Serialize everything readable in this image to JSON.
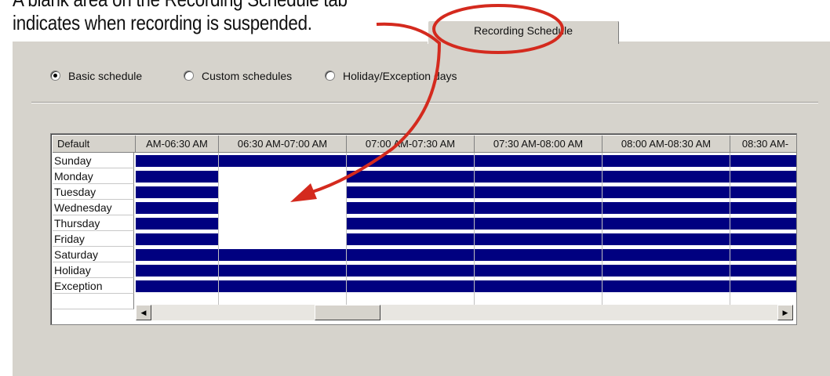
{
  "annotation": {
    "line1": "A blank area on the Recording Schedule tab",
    "line2": "indicates when recording is suspended."
  },
  "tab": {
    "label": "Recording Schedule"
  },
  "radio_options": [
    {
      "label": "Basic schedule",
      "selected": true
    },
    {
      "label": "Custom schedules",
      "selected": false
    },
    {
      "label": "Holiday/Exception days",
      "selected": false
    }
  ],
  "grid": {
    "corner_label": "Default",
    "columns": [
      "AM-06:30 AM",
      "06:30 AM-07:00 AM",
      "07:00 AM-07:30 AM",
      "07:30 AM-08:00 AM",
      "08:00 AM-08:30 AM",
      "08:30 AM-"
    ],
    "rows": [
      {
        "label": "Sunday",
        "recording": [
          true,
          true,
          true,
          true,
          true,
          true
        ]
      },
      {
        "label": "Monday",
        "recording": [
          true,
          false,
          true,
          true,
          true,
          true
        ]
      },
      {
        "label": "Tuesday",
        "recording": [
          true,
          false,
          true,
          true,
          true,
          true
        ]
      },
      {
        "label": "Wednesday",
        "recording": [
          true,
          false,
          true,
          true,
          true,
          true
        ]
      },
      {
        "label": "Thursday",
        "recording": [
          true,
          false,
          true,
          true,
          true,
          true
        ]
      },
      {
        "label": "Friday",
        "recording": [
          true,
          false,
          true,
          true,
          true,
          true
        ]
      },
      {
        "label": "Saturday",
        "recording": [
          true,
          true,
          true,
          true,
          true,
          true
        ]
      },
      {
        "label": "Holiday",
        "recording": [
          true,
          true,
          true,
          true,
          true,
          true
        ]
      },
      {
        "label": "Exception",
        "recording": [
          true,
          true,
          true,
          true,
          true,
          true
        ]
      }
    ]
  },
  "colors": {
    "recording_fill": "#000080",
    "panel_bg": "#d6d3cc",
    "callout_red": "#d42a1e"
  }
}
